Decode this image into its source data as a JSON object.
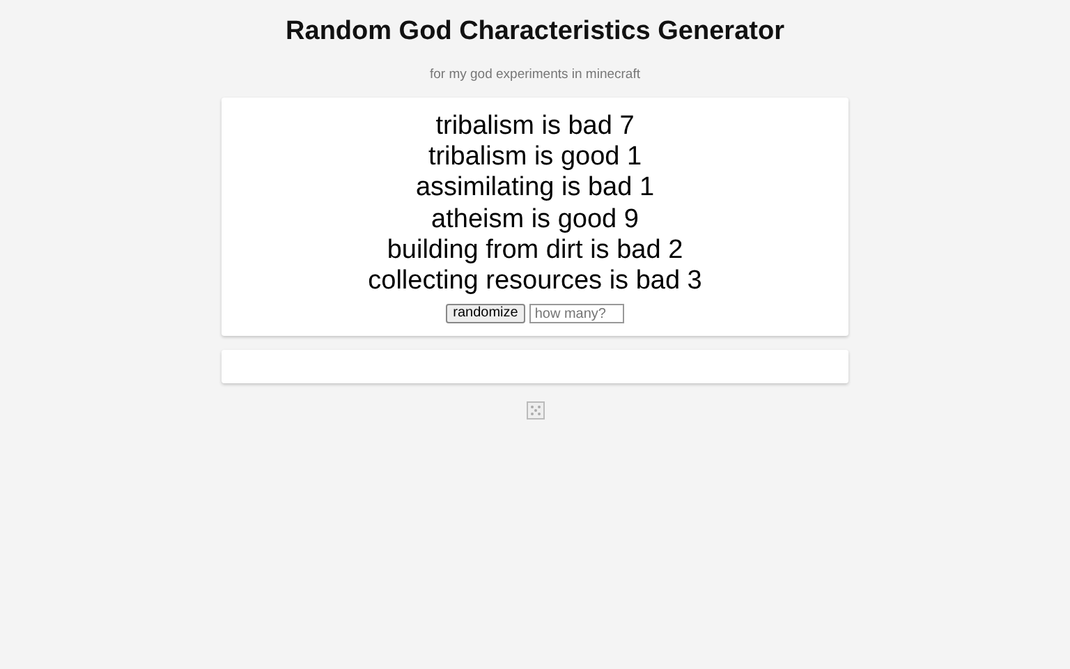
{
  "title": "Random God Characteristics Generator",
  "subtitle": "for my god experiments in minecraft",
  "results": [
    "tribalism is bad 7",
    "tribalism is good 1",
    "assimilating is bad 1",
    "atheism is good 9",
    "building from dirt is bad 2",
    "collecting resources is bad 3"
  ],
  "button": "randomize",
  "count_field": {
    "placeholder": "how many?"
  }
}
